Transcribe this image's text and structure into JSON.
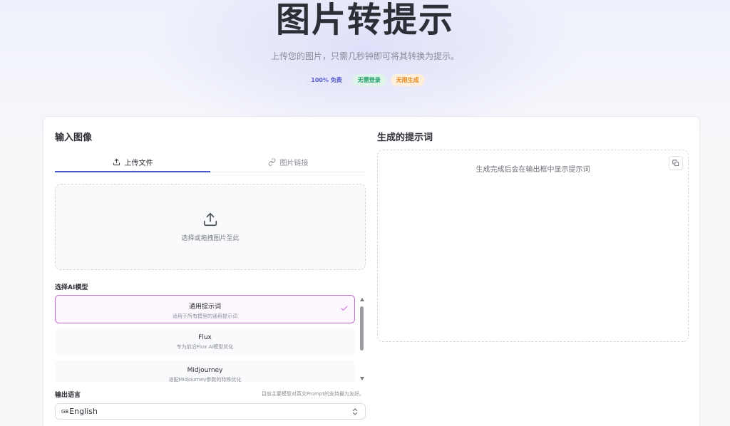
{
  "hero": {
    "title": "图片转提示",
    "subtitle": "上传您的图片，只需几秒钟即可将其转换为提示。",
    "badges": [
      "100% 免费",
      "无需登录",
      "无限生成"
    ]
  },
  "input": {
    "title": "输入图像",
    "tabs": [
      {
        "label": "上传文件",
        "icon": "upload-icon",
        "active": true
      },
      {
        "label": "图片链接",
        "icon": "link-icon",
        "active": false
      }
    ],
    "dropzone_text": "选择或拖拽图片至此"
  },
  "model": {
    "label": "选择AI模型",
    "items": [
      {
        "name": "通用提示词",
        "desc": "适用于所有模型的通用提示词",
        "selected": true
      },
      {
        "name": "Flux",
        "desc": "专为前沿Flux AI模型优化",
        "selected": false
      },
      {
        "name": "Midjourney",
        "desc": "适配Midjourney参数的特殊优化",
        "selected": false
      }
    ]
  },
  "language": {
    "label": "输出语言",
    "note": "目前主要模型对英文Prompt的支持最为友好。",
    "flag": "GB",
    "value": "English"
  },
  "output": {
    "title": "生成的提示词",
    "placeholder": "生成完成后会在输出框中显示提示词"
  },
  "colors": {
    "accent": "#4a57c8",
    "selected_border": "#c86bd9",
    "badge_free": "#5b5fd0",
    "badge_login": "#21a06a",
    "badge_unlimited": "#e48b1f"
  }
}
